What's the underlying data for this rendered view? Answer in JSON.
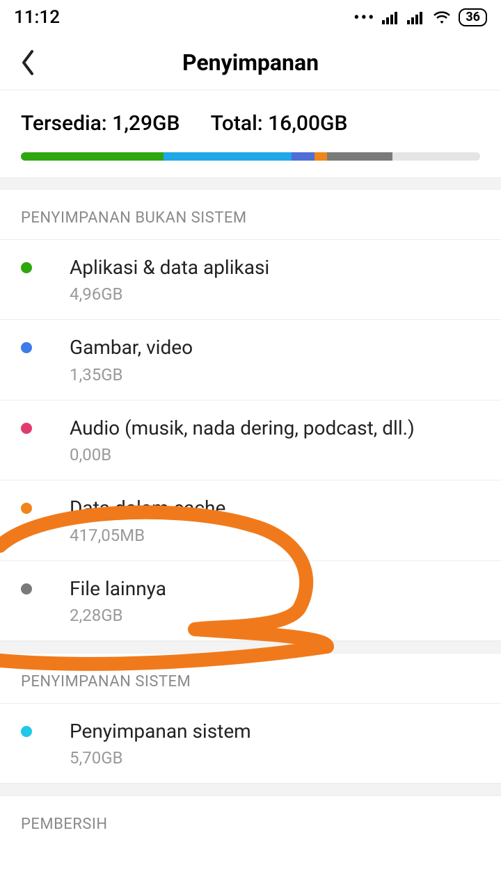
{
  "status": {
    "time": "11:12",
    "battery": "36"
  },
  "header": {
    "title": "Penyimpanan"
  },
  "summary": {
    "available_label": "Tersedia:",
    "available_value": "1,29GB",
    "total_label": "Total:",
    "total_value": "16,00GB"
  },
  "bar": {
    "segments": [
      {
        "color": "#2ea60f",
        "pct": 31.0
      },
      {
        "color": "#1fa7e8",
        "pct": 28.0
      },
      {
        "color": "#4f6fd6",
        "pct": 5.0
      },
      {
        "color": "#f08519",
        "pct": 2.6
      },
      {
        "color": "#7a7a7a",
        "pct": 14.3
      },
      {
        "color": "#e5e5e5",
        "pct": 19.1
      }
    ]
  },
  "sections": {
    "nonsystem": {
      "header": "PENYIMPANAN BUKAN SISTEM",
      "items": [
        {
          "dot": "#2ea60f",
          "title": "Aplikasi & data aplikasi",
          "size": "4,96GB"
        },
        {
          "dot": "#3d7be8",
          "title": "Gambar, video",
          "size": "1,35GB"
        },
        {
          "dot": "#e03a6f",
          "title": "Audio (musik, nada dering, podcast, dll.)",
          "size": "0,00B"
        },
        {
          "dot": "#f08519",
          "title": "Data dalam cache",
          "size": "417,05MB"
        },
        {
          "dot": "#7a7a7a",
          "title": "File lainnya",
          "size": "2,28GB"
        }
      ]
    },
    "system": {
      "header": "PENYIMPANAN SISTEM",
      "items": [
        {
          "dot": "#1fc7e8",
          "title": "Penyimpanan sistem",
          "size": "5,70GB"
        }
      ]
    },
    "cleaner": {
      "header": "PEMBERSIH"
    }
  },
  "annotation": {
    "color": "#f07a1b"
  }
}
